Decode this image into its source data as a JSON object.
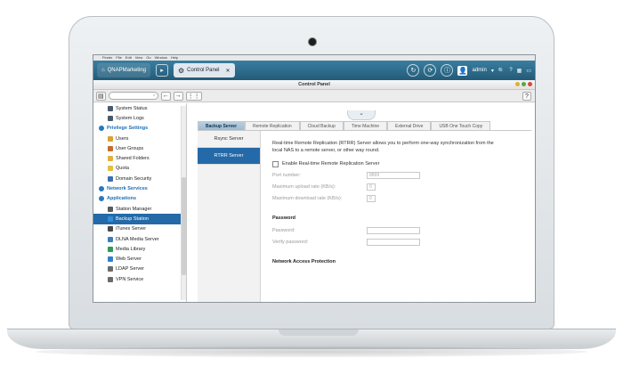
{
  "menubar": [
    "Finder",
    "File",
    "Edit",
    "View",
    "Go",
    "Window",
    "Help"
  ],
  "topbar": {
    "home_tab": "QNAPMarketing",
    "active_tab": "Control Panel",
    "user": "admin"
  },
  "window": {
    "title": "Control Panel"
  },
  "toolbar": {
    "search_placeholder": ""
  },
  "sidebar": {
    "items": [
      {
        "label": "System Status",
        "type": "sub",
        "icon": "monitor-icon",
        "color": "#4a5a6a"
      },
      {
        "label": "System Logs",
        "type": "sub",
        "icon": "document-icon",
        "color": "#4a5a6a"
      },
      {
        "label": "Privilege Settings",
        "type": "cat",
        "icon": "person-icon",
        "color": "#2a77c0"
      },
      {
        "label": "Users",
        "type": "sub",
        "icon": "user-icon",
        "color": "#d9a234"
      },
      {
        "label": "User Groups",
        "type": "sub",
        "icon": "group-icon",
        "color": "#c96a2e"
      },
      {
        "label": "Shared Folders",
        "type": "sub",
        "icon": "folder-icon",
        "color": "#e2b13c"
      },
      {
        "label": "Quota",
        "type": "sub",
        "icon": "quota-icon",
        "color": "#e0c040"
      },
      {
        "label": "Domain Security",
        "type": "sub",
        "icon": "domain-icon",
        "color": "#3a6fb0"
      },
      {
        "label": "Network Services",
        "type": "cat",
        "icon": "globe-icon",
        "color": "#2a77c0"
      },
      {
        "label": "Applications",
        "type": "cat",
        "icon": "apps-icon",
        "color": "#2a77c0"
      },
      {
        "label": "Station Manager",
        "type": "sub",
        "icon": "station-icon",
        "color": "#5b5b5b"
      },
      {
        "label": "Backup Station",
        "type": "sub",
        "icon": "backup-icon",
        "color": "#2e8fd6",
        "selected": true
      },
      {
        "label": "iTunes Server",
        "type": "sub",
        "icon": "itunes-icon",
        "color": "#4a4a4a"
      },
      {
        "label": "DLNA Media Server",
        "type": "sub",
        "icon": "dlna-icon",
        "color": "#3a7fc0"
      },
      {
        "label": "Media Library",
        "type": "sub",
        "icon": "library-icon",
        "color": "#2f9a5a"
      },
      {
        "label": "Web Server",
        "type": "sub",
        "icon": "web-icon",
        "color": "#2f7fd0"
      },
      {
        "label": "LDAP Server",
        "type": "sub",
        "icon": "ldap-icon",
        "color": "#6a6a6a"
      },
      {
        "label": "VPN Service",
        "type": "sub",
        "icon": "vpn-icon",
        "color": "#6a6a6a"
      }
    ]
  },
  "tabs": [
    {
      "label": "Backup Server",
      "active": true
    },
    {
      "label": "Remote Replication"
    },
    {
      "label": "Cloud Backup"
    },
    {
      "label": "Time Machine"
    },
    {
      "label": "External Drive"
    },
    {
      "label": "USB One Touch Copy"
    }
  ],
  "subnav": [
    {
      "label": "Rsync Server"
    },
    {
      "label": "RTRR Server",
      "active": true
    }
  ],
  "form": {
    "description": "Real-time Remote Replication (RTRR) Server allows you to perform one-way synchronization from the local NAS to a remote server, or other way round.",
    "enable_label": "Enable Real-time Remote Replication Server",
    "port_label": "Port number:",
    "port_value": "8899",
    "upload_label": "Maximum upload rate (KB/s):",
    "upload_value": "0",
    "download_label": "Maximum download rate (KB/s):",
    "download_value": "0",
    "password_heading": "Password",
    "password_label": "Password:",
    "verify_label": "Verify password:",
    "network_heading": "Network Access Protection"
  },
  "colors": {
    "accent": "#246aa8",
    "topbar": "#2f6e8f"
  }
}
